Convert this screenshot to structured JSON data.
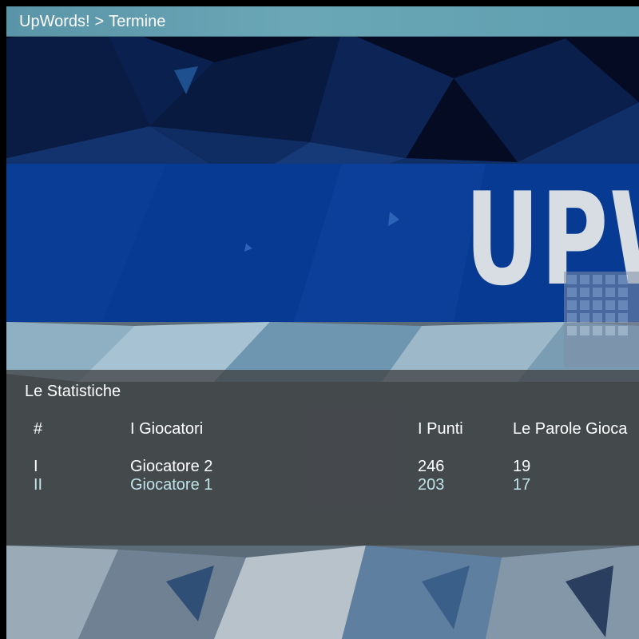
{
  "breadcrumb": {
    "app": "UpWords!",
    "separator": ">",
    "current": "Termine"
  },
  "banner": {
    "logo_text": "UPW"
  },
  "stats": {
    "title": "Le Statistiche",
    "columns": [
      "#",
      "I Giocatori",
      "I Punti",
      "Le Parole Gioca"
    ],
    "rows": [
      {
        "rank": "I",
        "player": "Giocatore 2",
        "points": "246",
        "words": "19"
      },
      {
        "rank": "II",
        "player": "Giocatore 1",
        "points": "203",
        "words": "17"
      }
    ]
  },
  "colors": {
    "titlebar": "#5f9fb0",
    "banner": "#073a93",
    "logo": "#d7dde3",
    "panel": "#3c3c3c",
    "highlight_row": "#bfe3e8"
  }
}
